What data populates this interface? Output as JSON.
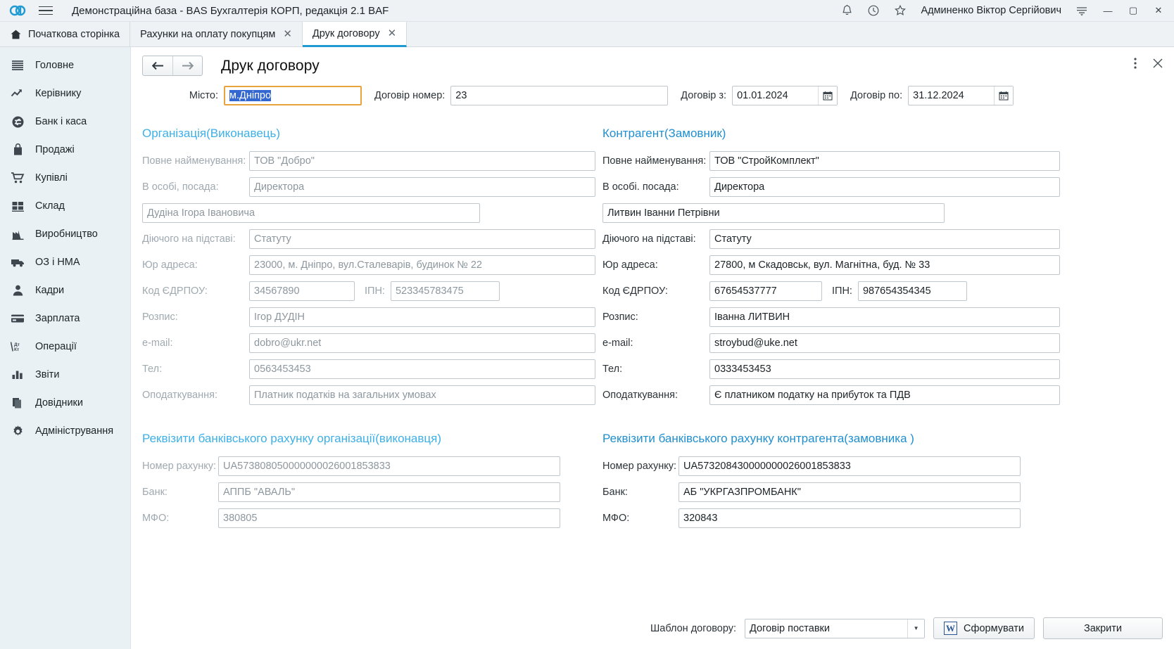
{
  "titlebar": {
    "app_title": "Демонстраційна база - BAS Бухгалтерія КОРП, редакція 2.1 BAF",
    "user": "Админенко Віктор Сергійович",
    "icons": [
      "bell-icon",
      "history-icon",
      "star-icon",
      "menu-lines-icon"
    ],
    "window_buttons": {
      "minimize": "—",
      "maximize": "▢",
      "close": "✕"
    }
  },
  "tabs": [
    {
      "label": "Початкова сторінка",
      "icon": "home-icon",
      "closable": false,
      "active": false
    },
    {
      "label": "Рахунки на оплату покупцям",
      "closable": true,
      "close_label": "✕",
      "active": false
    },
    {
      "label": "Друк договору",
      "closable": true,
      "close_label": "✕",
      "active": true
    }
  ],
  "sidebar": {
    "items": [
      {
        "label": "Головне",
        "icon": "lines-icon"
      },
      {
        "label": "Керівнику",
        "icon": "trend-up-icon"
      },
      {
        "label": "Банк і каса",
        "icon": "coin-icon"
      },
      {
        "label": "Продажі",
        "icon": "bag-icon"
      },
      {
        "label": "Купівлі",
        "icon": "cart-icon"
      },
      {
        "label": "Склад",
        "icon": "grid-icon"
      },
      {
        "label": "Виробництво",
        "icon": "factory-icon"
      },
      {
        "label": "ОЗ і НМА",
        "icon": "truck-icon"
      },
      {
        "label": "Кадри",
        "icon": "person-icon"
      },
      {
        "label": "Зарплата",
        "icon": "card-icon"
      },
      {
        "label": "Операції",
        "icon": "debit-credit-icon"
      },
      {
        "label": "Звіти",
        "icon": "bar-chart-icon"
      },
      {
        "label": "Довідники",
        "icon": "books-icon"
      },
      {
        "label": "Адміністрування",
        "icon": "gear-icon"
      }
    ]
  },
  "form": {
    "title": "Друк договору",
    "nav_back": "←",
    "nav_forward": "→",
    "more_icon": "kebab-menu-icon",
    "close_icon": "close-icon",
    "top": {
      "city_label": "Місто:",
      "city_value": "м.Дніпро",
      "contract_number_label": "Договір номер:",
      "contract_number_value": "23",
      "date_from_label": "Договір з:",
      "date_from_value": "01.01.2024",
      "date_to_label": "Договір по:",
      "date_to_value": "31.12.2024",
      "calendar_icon": "calendar-icon"
    },
    "organization": {
      "section_title": "Організація(Виконавець)",
      "full_name_label": "Повне найменування:",
      "full_name_value": "ТОВ \"Добро\"",
      "person_position_label": "В особі, посада:",
      "person_position_value": "Директора",
      "person_name_value": "Дудіна Ігора Івановича",
      "basis_label": "Діючого на підставі:",
      "basis_value": "Статуту",
      "legal_address_label": "Юр адреса:",
      "legal_address_value": "23000, м. Дніпро, вул.Сталеварів, будинок № 22",
      "edrpou_label": "Код ЄДРПОУ:",
      "edrpou_value": "34567890",
      "ipn_label": "ІПН:",
      "ipn_value": "523345783475",
      "signature_label": "Розпис:",
      "signature_value": "Ігор ДУДІН",
      "email_label": "e-mail:",
      "email_value": "dobro@ukr.net",
      "phone_label": "Тел:",
      "phone_value": "0563453453",
      "tax_label": "Оподаткування:",
      "tax_value": "Платник податків на загальних умовах"
    },
    "counterparty": {
      "section_title": "Контрагент(Замовник)",
      "full_name_label": "Повне найменування:",
      "full_name_value": "ТОВ \"СтройКомплект\"",
      "person_position_label": "В особі. посада:",
      "person_position_value": "Директора",
      "person_name_value": "Литвин Іванни Петрівни",
      "basis_label": "Діючого на підставі:",
      "basis_value": "Статуту",
      "legal_address_label": "Юр адреса:",
      "legal_address_value": "27800, м Скадовськ, вул. Магнітна, буд. № 33",
      "edrpou_label": "Код ЄДРПОУ:",
      "edrpou_value": "67654537777",
      "ipn_label": "ІПН:",
      "ipn_value": "987654354345",
      "signature_label": "Розпис:",
      "signature_value": "Іванна ЛИТВИН",
      "email_label": "e-mail:",
      "email_value": "stroybud@uke.net",
      "phone_label": "Тел:",
      "phone_value": "0333453453",
      "tax_label": "Оподаткування:",
      "tax_value": "Є платником податку на прибуток та ПДВ"
    },
    "org_bank": {
      "section_title": "Реквізити банківського рахунку організації(виконавця)",
      "account_label": "Номер рахунку:",
      "account_value": "UA573808050000000026001853833",
      "bank_label": "Банк:",
      "bank_value": "АППБ \"АВАЛЬ\"",
      "mfo_label": "МФО:",
      "mfo_value": "380805"
    },
    "counterparty_bank": {
      "section_title": "Реквізити банківського рахунку контрагента(замовника )",
      "account_label": "Номер рахунку:",
      "account_value": "UA573208430000000026001853833",
      "bank_label": "Банк:",
      "bank_value": "АБ \"УКРГАЗПРОМБАНК\"",
      "mfo_label": "МФО:",
      "mfo_value": "320843"
    },
    "footer": {
      "template_label": "Шаблон договору:",
      "template_value": "Договір поставки",
      "dropdown_icon": "chevron-down-icon",
      "generate_label": "Сформувати",
      "generate_icon": "word-icon",
      "generate_icon_letter": "W",
      "close_label": "Закрити"
    }
  },
  "colors": {
    "accent": "#1f9bd1",
    "section_title": "#3db0e8",
    "focus_border": "#e8a33d",
    "selection_bg": "#3063c8",
    "sidebar_bg": "#eaf1f5",
    "titlebar_bg": "#eef2f5"
  }
}
